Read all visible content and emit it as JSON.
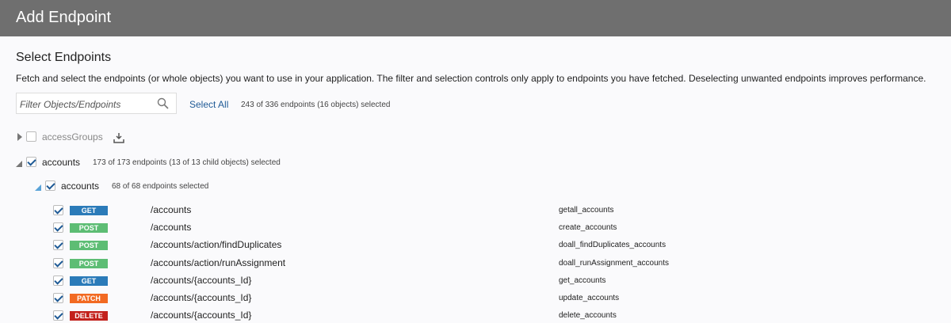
{
  "header": {
    "title": "Add Endpoint"
  },
  "section": {
    "title": "Select Endpoints",
    "description": "Fetch and select the endpoints (or whole objects) you want to use in your application. The filter and selection controls only apply to endpoints you have fetched. Deselecting unwanted endpoints improves performance."
  },
  "filter": {
    "placeholder": "Filter Objects/Endpoints",
    "select_all": "Select All",
    "summary": "243 of 336 endpoints (16 objects) selected"
  },
  "tree": [
    {
      "label": "accessGroups",
      "checked": false,
      "summary": ""
    },
    {
      "label": "accounts",
      "checked": true,
      "summary": "173 of 173 endpoints (13 of 13 child objects) selected"
    },
    {
      "label": "accounts",
      "checked": true,
      "summary": "68 of 68 endpoints selected"
    }
  ],
  "colors": {
    "GET": "#2b7bb9",
    "POST": "#5dbd74",
    "PATCH": "#f26a22",
    "DELETE": "#c3211c"
  },
  "endpoints": [
    {
      "method": "GET",
      "path": "/accounts",
      "op": "getall_accounts"
    },
    {
      "method": "POST",
      "path": "/accounts",
      "op": "create_accounts"
    },
    {
      "method": "POST",
      "path": "/accounts/action/findDuplicates",
      "op": "doall_findDuplicates_accounts"
    },
    {
      "method": "POST",
      "path": "/accounts/action/runAssignment",
      "op": "doall_runAssignment_accounts"
    },
    {
      "method": "GET",
      "path": "/accounts/{accounts_Id}",
      "op": "get_accounts"
    },
    {
      "method": "PATCH",
      "path": "/accounts/{accounts_Id}",
      "op": "update_accounts"
    },
    {
      "method": "DELETE",
      "path": "/accounts/{accounts_Id}",
      "op": "delete_accounts"
    }
  ]
}
